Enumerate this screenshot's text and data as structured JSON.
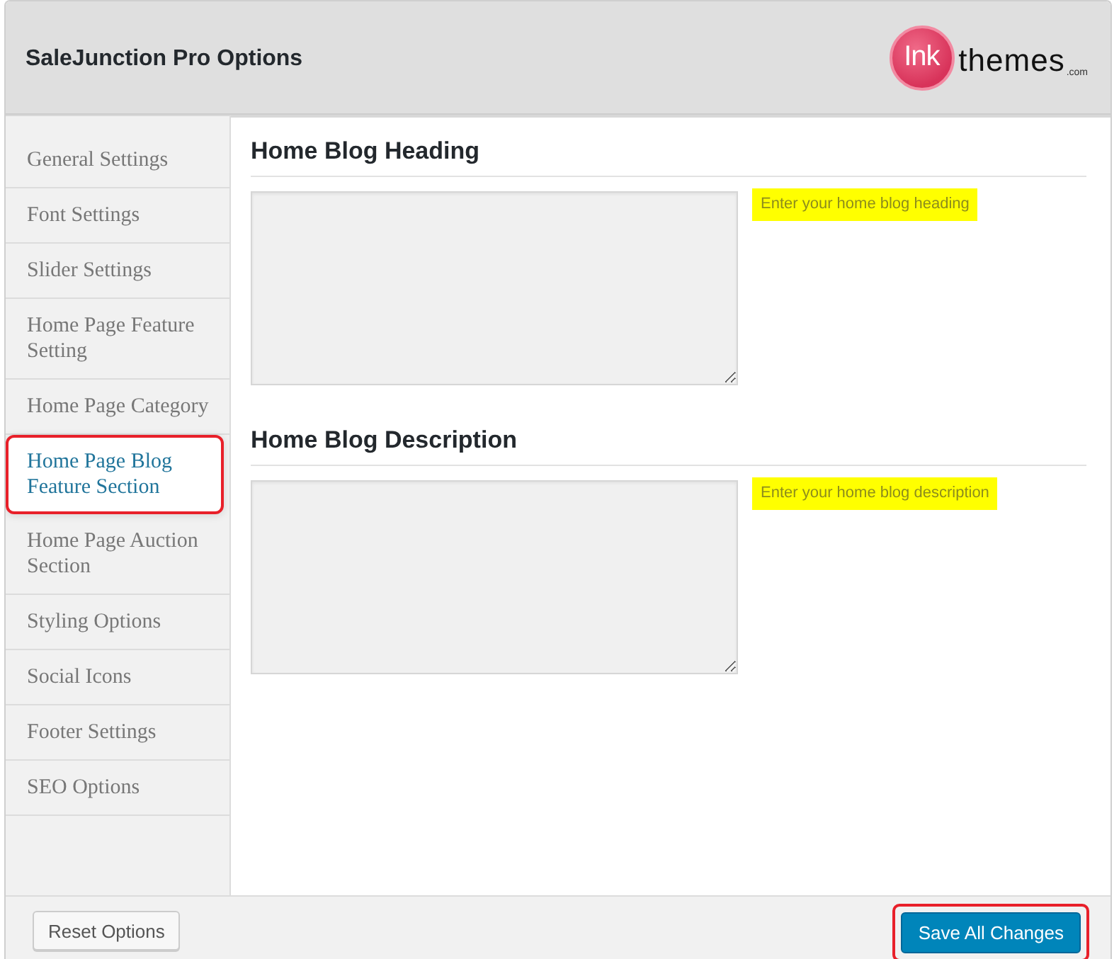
{
  "window": {
    "title": "SaleJunction Pro Options"
  },
  "logo": {
    "mark": "Ink",
    "name": "themes",
    "suffix": ".com"
  },
  "sidebar": {
    "items": [
      {
        "label": "General Settings",
        "selected": false,
        "highlighted": false
      },
      {
        "label": "Font Settings",
        "selected": false,
        "highlighted": false
      },
      {
        "label": "Slider Settings",
        "selected": false,
        "highlighted": false
      },
      {
        "label": "Home Page Feature Setting",
        "selected": false,
        "highlighted": false
      },
      {
        "label": "Home Page Category",
        "selected": false,
        "highlighted": false
      },
      {
        "label": "Home Page Blog Feature Section",
        "selected": true,
        "highlighted": true
      },
      {
        "label": "Home Page Auction Section",
        "selected": false,
        "highlighted": false
      },
      {
        "label": "Styling Options",
        "selected": false,
        "highlighted": false
      },
      {
        "label": "Social Icons",
        "selected": false,
        "highlighted": false
      },
      {
        "label": "Footer Settings",
        "selected": false,
        "highlighted": false
      },
      {
        "label": "SEO Options",
        "selected": false,
        "highlighted": false
      }
    ]
  },
  "sections": [
    {
      "heading": "Home Blog Heading",
      "hint": "Enter your home blog heading"
    },
    {
      "heading": "Home Blog Description",
      "hint": "Enter your home blog description"
    }
  ],
  "footer": {
    "buttons": [
      {
        "label": "Reset Options",
        "kind": "secondary",
        "highlighted": false
      },
      {
        "label": "Save All Changes",
        "kind": "primary",
        "highlighted": true
      }
    ]
  }
}
